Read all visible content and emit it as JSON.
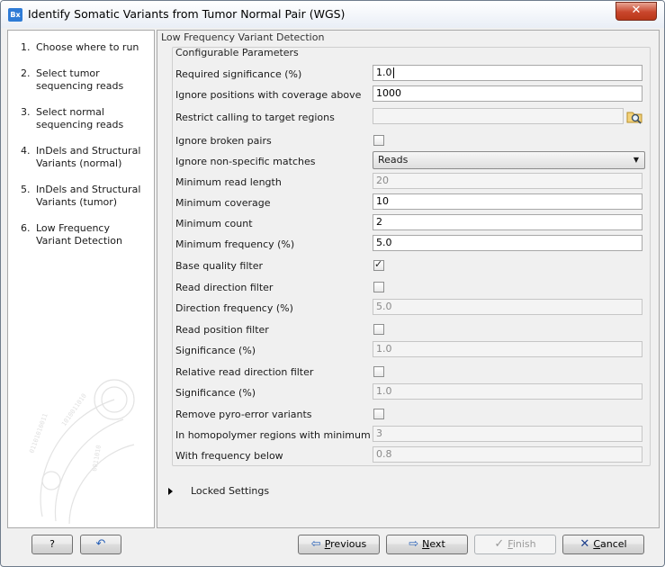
{
  "window": {
    "title": "Identify Somatic Variants from Tumor Normal Pair (WGS)",
    "icon_text": "Bx",
    "close_glyph": "✕"
  },
  "steps": [
    {
      "num": "1.",
      "label": "Choose where to run"
    },
    {
      "num": "2.",
      "label": "Select tumor sequencing reads"
    },
    {
      "num": "3.",
      "label": "Select normal sequencing reads"
    },
    {
      "num": "4.",
      "label": "InDels and Structural Variants (normal)"
    },
    {
      "num": "5.",
      "label": "InDels and Structural Variants (tumor)"
    },
    {
      "num": "6.",
      "label": "Low Frequency Variant Detection"
    }
  ],
  "main": {
    "header": "Low Frequency Variant Detection",
    "group_title": "Configurable Parameters",
    "params": {
      "required_significance": {
        "label": "Required significance (%)",
        "value": "1.0"
      },
      "ignore_coverage_above": {
        "label": "Ignore positions with coverage above",
        "value": "1000"
      },
      "restrict_target": {
        "label": "Restrict calling to target regions",
        "value": ""
      },
      "ignore_broken_pairs": {
        "label": "Ignore broken pairs",
        "checked": false
      },
      "ignore_nonspecific": {
        "label": "Ignore non-specific matches",
        "value": "Reads"
      },
      "min_read_length": {
        "label": "Minimum read length",
        "value": "20"
      },
      "min_coverage": {
        "label": "Minimum coverage",
        "value": "10"
      },
      "min_count": {
        "label": "Minimum count",
        "value": "2"
      },
      "min_frequency": {
        "label": "Minimum frequency (%)",
        "value": "5.0"
      },
      "base_quality_filter": {
        "label": "Base quality filter",
        "checked": true
      },
      "read_direction_filter": {
        "label": "Read direction filter",
        "checked": false
      },
      "direction_frequency": {
        "label": "Direction frequency (%)",
        "value": "5.0"
      },
      "read_position_filter": {
        "label": "Read position filter",
        "checked": false
      },
      "significance_1": {
        "label": "Significance (%)",
        "value": "1.0"
      },
      "relative_read_direction_filter": {
        "label": "Relative read direction filter",
        "checked": false
      },
      "significance_2": {
        "label": "Significance (%)",
        "value": "1.0"
      },
      "remove_pyro_error": {
        "label": "Remove pyro-error variants",
        "checked": false
      },
      "homopolymer_min_length": {
        "label": "In homopolymer regions with minimum length",
        "value": "3"
      },
      "with_frequency_below": {
        "label": "With frequency below",
        "value": "0.8"
      }
    },
    "locked_settings": "Locked Settings"
  },
  "buttons": {
    "help": "?",
    "reset": "↶",
    "previous": {
      "mnemonic": "P",
      "rest": "revious",
      "icon": "⇦"
    },
    "next": {
      "mnemonic": "N",
      "rest": "ext",
      "icon": "⇨"
    },
    "finish": {
      "mnemonic": "F",
      "rest": "inish",
      "icon": "✓"
    },
    "cancel": {
      "mnemonic": "C",
      "rest": "ancel",
      "icon": "✕"
    }
  },
  "colors": {
    "accent": "#2e7bd6",
    "close": "#c9462c"
  }
}
